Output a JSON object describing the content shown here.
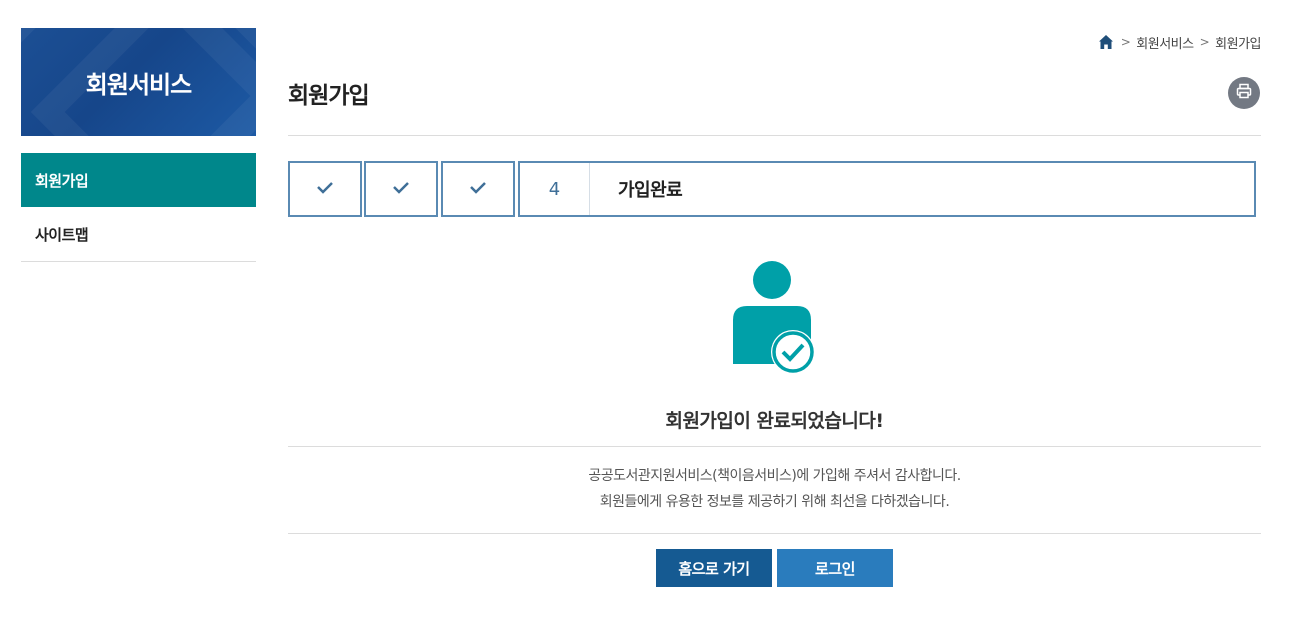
{
  "sidebar": {
    "title": "회원서비스",
    "items": [
      {
        "label": "회원가입",
        "active": true
      },
      {
        "label": "사이트맵",
        "active": false
      }
    ]
  },
  "breadcrumb": {
    "home_icon": "home-icon",
    "items": [
      "회원서비스",
      "회원가입"
    ],
    "separator": ">"
  },
  "page": {
    "title": "회원가입",
    "print_icon": "printer-icon"
  },
  "steps": {
    "completed_icon": "check-icon",
    "current_number": "4",
    "current_label": "가입완료"
  },
  "completion": {
    "icon": "user-check-icon",
    "message": "회원가입이 완료되었습니다!",
    "description_line1": "공공도서관지원서비스(책이음서비스)에 가입해 주셔서 감사합니다.",
    "description_line2": "회원들에게 유용한 정보를 제공하기 위해 최선을 다하겠습니다."
  },
  "buttons": {
    "home_label": "홈으로 가기",
    "login_label": "로그인"
  },
  "colors": {
    "banner": "#16468a",
    "active_menu": "#00878b",
    "step_border": "#5a8ab3",
    "icon_teal": "#00a0a8",
    "btn_home": "#155a92",
    "btn_login": "#2a7cbd"
  }
}
